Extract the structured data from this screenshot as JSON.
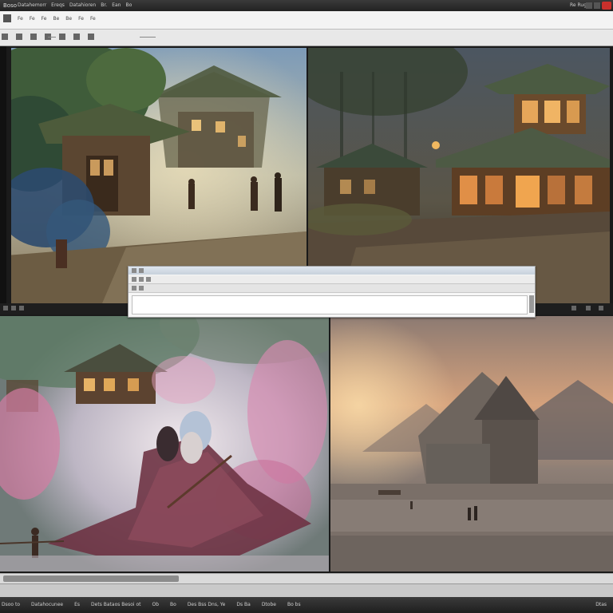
{
  "window": {
    "title": "Boso",
    "menu": [
      "Datahemorr",
      "Ereqs",
      "Datahioren",
      "Br.",
      "Ean",
      "Bo"
    ],
    "right_label": "Re Rugic"
  },
  "toolbar": {
    "items": [
      "Fe",
      "Fe",
      "Fe",
      "Be",
      "Be",
      "Fe",
      "Fe"
    ]
  },
  "taskbar": {
    "items": [
      "Dsoo to",
      "Datahocunee",
      "Es",
      "Dets Bataos Besoi ot",
      "Ob",
      "Bo",
      "Des Bss Dns, Ye",
      "Ds Ba",
      "Dtobe",
      "Bo bs"
    ],
    "clock": "Dtas"
  },
  "panels": {
    "top_left": "village-forest-scene",
    "top_right": "pagoda-night-scene",
    "bottom_left": "blossom-cloak-figure",
    "bottom_right": "misty-castle-sunset"
  },
  "colors": {
    "titlebar": "#2a2a2a",
    "close_button": "#c9302c",
    "toolbar": "#f3f3f3",
    "dialog": "#f6f6f6"
  }
}
